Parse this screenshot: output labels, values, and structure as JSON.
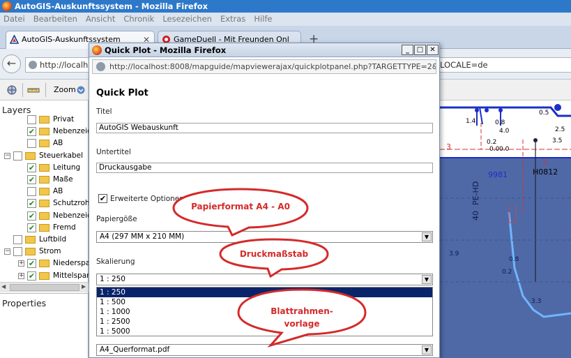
{
  "window": {
    "title": "AutoGIS-Auskunftssystem - Mozilla Firefox"
  },
  "menu": [
    "Datei",
    "Bearbeiten",
    "Ansicht",
    "Chronik",
    "Lesezeichen",
    "Extras",
    "Hilfe"
  ],
  "tabs": [
    {
      "label": "AutoGIS-Auskunftssystem",
      "active": true
    },
    {
      "label": "GameDuell - Mit Freunden Onl",
      "active": false
    }
  ],
  "newtab": "+",
  "address": {
    "visible": "http://localhost",
    "tail": "LOCALE=de"
  },
  "toolbar": {
    "zoom_label": "Zoom"
  },
  "layers": {
    "header": "Layers",
    "items": [
      {
        "label": "Privat",
        "checked": false,
        "indent": 2
      },
      {
        "label": "Nebenzeic",
        "checked": true,
        "indent": 2
      },
      {
        "label": "AB",
        "checked": false,
        "indent": 2
      },
      {
        "label": "Steuerkabel",
        "checked": false,
        "indent": 1,
        "expander": "−"
      },
      {
        "label": "Leitung",
        "checked": true,
        "indent": 2
      },
      {
        "label": "Maße",
        "checked": true,
        "indent": 2
      },
      {
        "label": "AB",
        "checked": false,
        "indent": 2
      },
      {
        "label": "Schutzroh",
        "checked": true,
        "indent": 2
      },
      {
        "label": "Nebenzeic",
        "checked": true,
        "indent": 2
      },
      {
        "label": "Fremd",
        "checked": true,
        "indent": 2
      },
      {
        "label": "Luftbild",
        "checked": false,
        "indent": 1
      },
      {
        "label": "Strom",
        "checked": false,
        "indent": 1,
        "expander": "−"
      },
      {
        "label": "Niederspa",
        "checked": true,
        "indent": 2,
        "expander": "+"
      },
      {
        "label": "Mittelspar",
        "checked": true,
        "indent": 2,
        "expander": "+"
      }
    ]
  },
  "properties": {
    "header": "Properties"
  },
  "dialog": {
    "title": "Quick Plot - Mozilla Firefox",
    "url": "http://localhost:8008/mapguide/mapviewerajax/quickplotpanel.php?TARGETTYPE=2&WIDTH=4",
    "heading": "Quick Plot",
    "title_label": "Titel",
    "title_value": "AutoGIS Webauskunft",
    "subtitle_label": "Untertitel",
    "subtitle_value": "Druckausgabe",
    "advanced_label": "Erweiterte Optionen",
    "advanced_checked": true,
    "paper_label": "Papiergöße",
    "paper_value": "A4 (297 MM x 210 MM)",
    "scale_label": "Skalierung",
    "scale_value": "1 : 250",
    "scale_options": [
      "1 : 250",
      "1 : 500",
      "1 : 1000",
      "1 : 2500",
      "1 : 5000"
    ],
    "template_value": "A4_Querformat.pdf"
  },
  "annotations": {
    "paper": "Papierformat A4 - A0",
    "scale": "Druckmaßstab",
    "frame_line1": "Blattrahmen-",
    "frame_line2": "vorlage"
  },
  "map_labels": {
    "n05": "0.5",
    "n14": "1.4",
    "n08": "0.8",
    "n40": "4.0",
    "n00a": "0.0",
    "n00b": "0.0",
    "n02": "0.2",
    "n25": "2.5",
    "n35": "3.5",
    "n3": "3",
    "n2": "2",
    "h0812": "H0812",
    "n9981": "9981",
    "n40b": "40",
    "pehd": "PE-HD",
    "n39": "3.9",
    "n08b": "0.8",
    "n02b": "0.2",
    "n33": "3.3"
  },
  "colors": {
    "map_blue": "#1b2fc8",
    "map_area": "#4f69a6",
    "annotation_red": "#d42a2a",
    "selection": "#0a246a"
  }
}
